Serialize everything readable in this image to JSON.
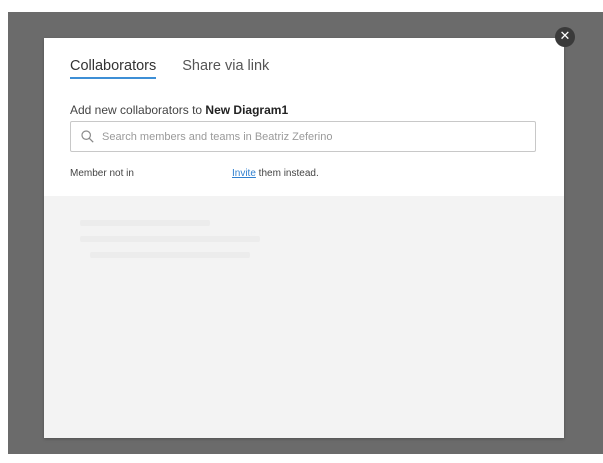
{
  "dialog": {
    "tabs": [
      {
        "label": "Collaborators",
        "active": true
      },
      {
        "label": "Share via link",
        "active": false
      }
    ],
    "add_prefix": "Add new collaborators to ",
    "diagram_name": "New Diagram1",
    "search": {
      "placeholder": "Search members and teams in Beatriz Zeferino",
      "value": ""
    },
    "member_not_in": "Member not in",
    "invite_link": "Invite",
    "invite_suffix": " them instead.",
    "close_symbol": "✕"
  },
  "icons": {
    "search": "search-icon",
    "close": "close-icon"
  },
  "colors": {
    "accent": "#3d8fd6",
    "link": "#2f7fcf",
    "backdrop": "#6b6b6b",
    "lower_area": "#f3f3f3"
  }
}
